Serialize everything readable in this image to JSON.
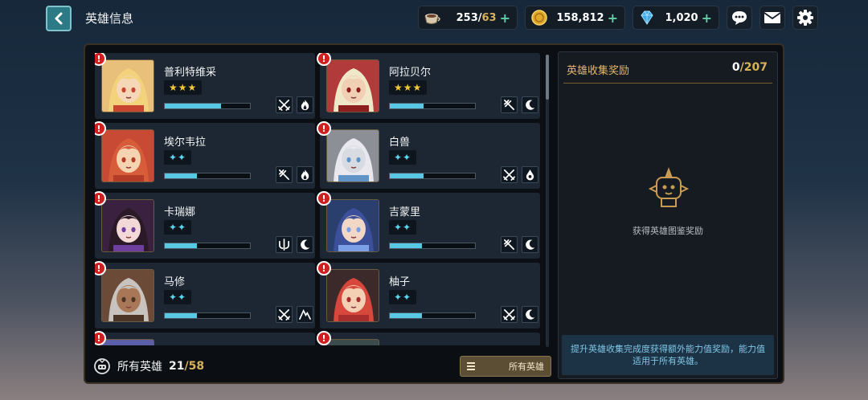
{
  "header": {
    "title": "英雄信息",
    "resources": [
      {
        "name": "coffee",
        "value": "253",
        "max": "63",
        "icon": "coffee-cup-icon"
      },
      {
        "name": "gold",
        "value": "158,812",
        "icon": "gold-coin-icon"
      },
      {
        "name": "gem",
        "value": "1,020",
        "icon": "diamond-icon"
      }
    ],
    "buttons": [
      "chat-icon",
      "mail-icon",
      "gear-icon"
    ]
  },
  "heroes": [
    {
      "name": "普利特维采",
      "stars": "★★★",
      "star_color": "gold",
      "exp": 0.66,
      "class_icons": [
        "crossed-swords-icon",
        "fire-icon"
      ]
    },
    {
      "name": "阿拉贝尔",
      "stars": "★★★",
      "star_color": "gold",
      "exp": 0.4,
      "class_icons": [
        "crossed-bow-icon",
        "moon-icon"
      ]
    },
    {
      "name": "埃尔韦拉",
      "stars": "✦✦",
      "star_color": "blue",
      "exp": 0.38,
      "class_icons": [
        "crossed-bow-icon",
        "fire-icon"
      ]
    },
    {
      "name": "白兽",
      "stars": "✦✦",
      "star_color": "blue",
      "exp": 0.4,
      "class_icons": [
        "crossed-swords-icon",
        "water-drop-icon"
      ]
    },
    {
      "name": "卡瑞娜",
      "stars": "✦✦",
      "star_color": "blue",
      "exp": 0.38,
      "class_icons": [
        "shield-staff-icon",
        "moon-icon"
      ]
    },
    {
      "name": "吉蒙里",
      "stars": "✦✦",
      "star_color": "blue",
      "exp": 0.38,
      "class_icons": [
        "crossed-bow-icon",
        "moon-icon"
      ]
    },
    {
      "name": "马修",
      "stars": "✦✦",
      "star_color": "blue",
      "exp": 0.38,
      "class_icons": [
        "crossed-swords-icon",
        "mountain-icon"
      ]
    },
    {
      "name": "柚子",
      "stars": "✦✦",
      "star_color": "blue",
      "exp": 0.38,
      "class_icons": [
        "crossed-swords-icon",
        "moon-icon"
      ]
    }
  ],
  "footer": {
    "all_heroes_label": "所有英雄",
    "owned": "21",
    "total": "58",
    "filter_label": "所有英雄"
  },
  "collection": {
    "title": "英雄收集奖励",
    "progress": "0",
    "max": "207",
    "reward_text": "获得英雄图鉴奖励",
    "info": "提升英雄收集完成度获得额外能力值奖励，能力值适用于所有英雄。"
  }
}
